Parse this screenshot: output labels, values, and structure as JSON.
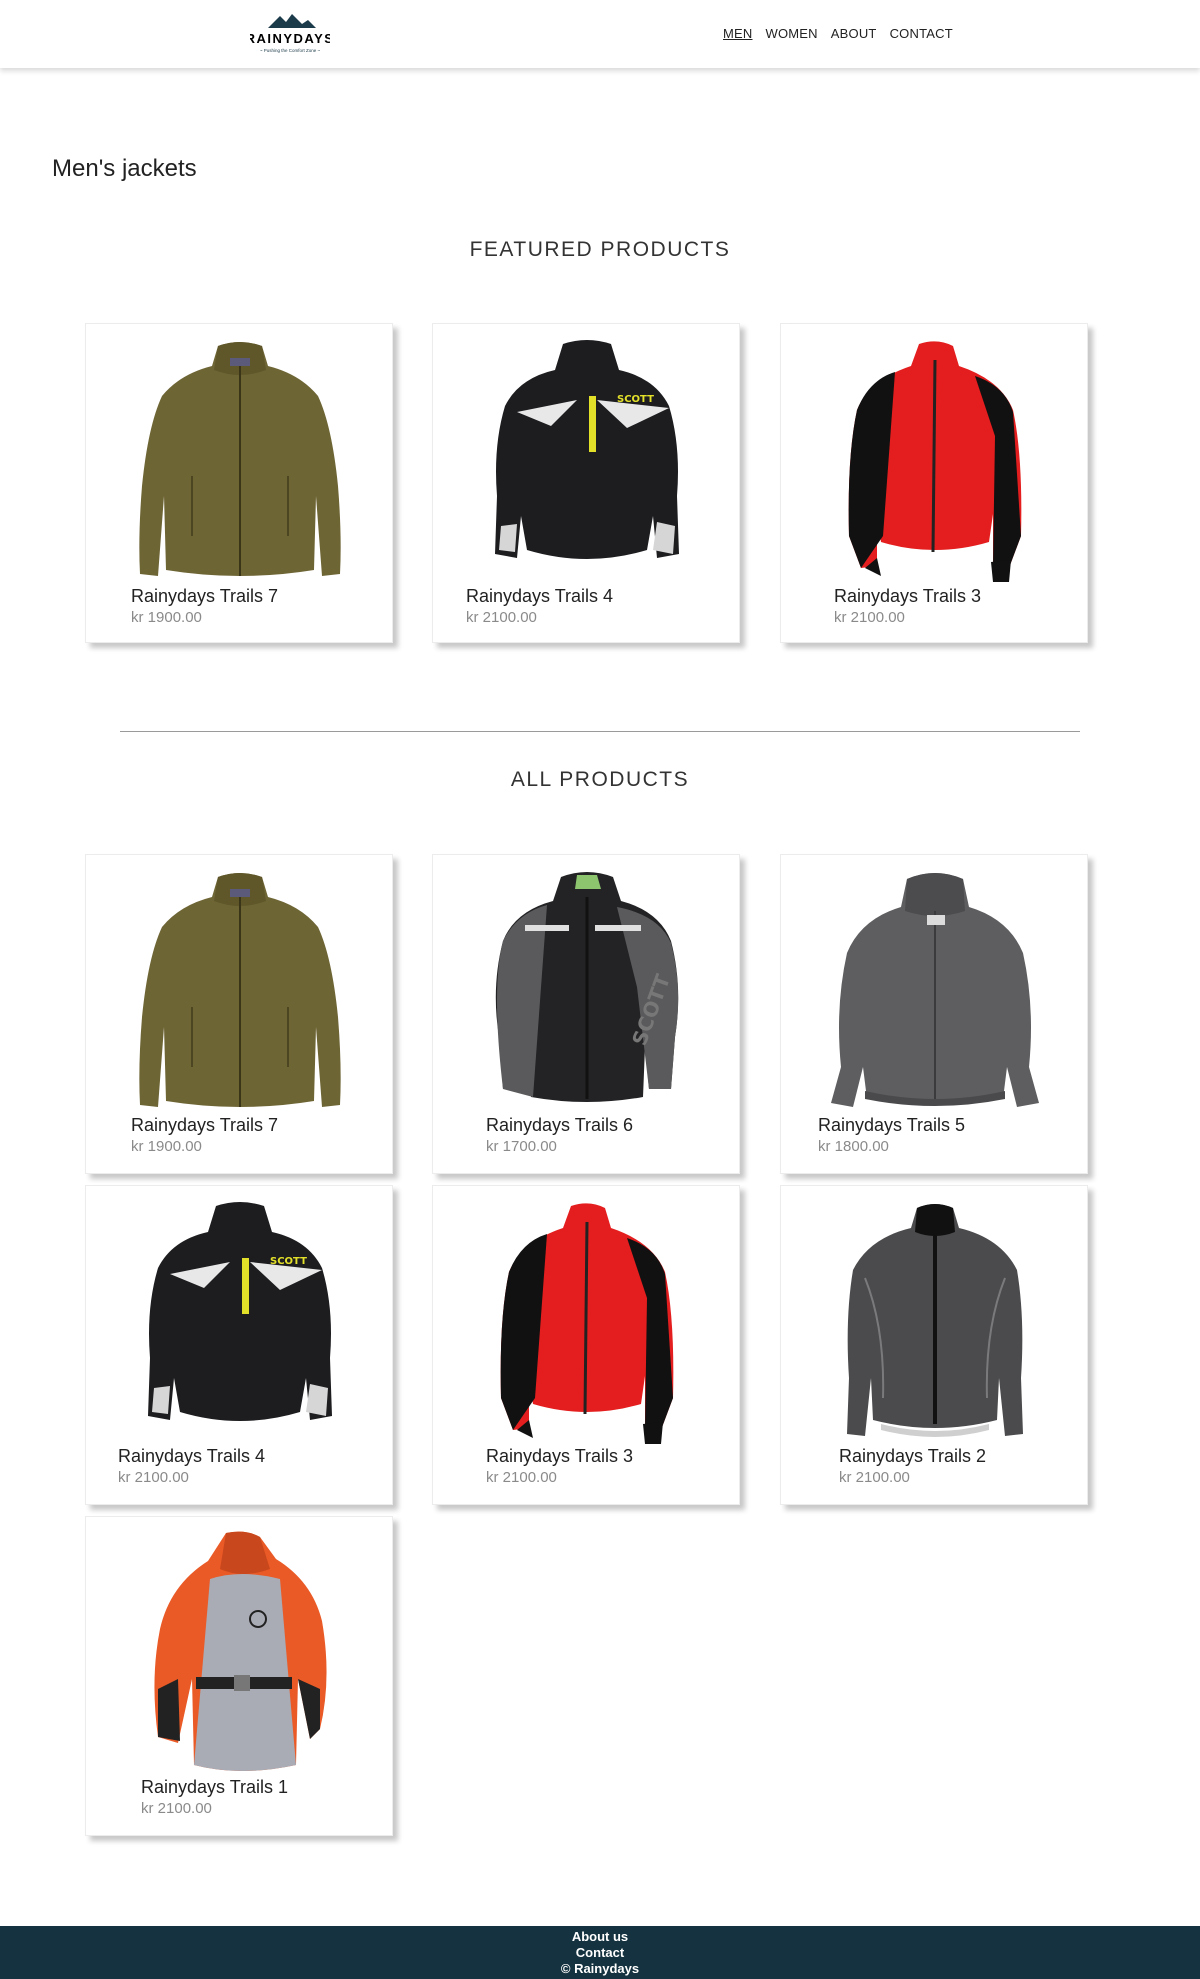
{
  "header": {
    "logo_text": "RAINYDAYS",
    "logo_tagline": "~ Pushing the Comfort Zone ~",
    "nav": [
      {
        "label": "MEN",
        "active": true
      },
      {
        "label": "WOMEN",
        "active": false
      },
      {
        "label": "ABOUT",
        "active": false
      },
      {
        "label": "CONTACT",
        "active": false
      }
    ]
  },
  "page_title": "Men's jackets",
  "featured": {
    "title": "FEATURED PRODUCTS",
    "products": [
      {
        "name": "Rainydays Trails 7",
        "price": "kr 1900.00",
        "icon": "olive-fleece-jacket"
      },
      {
        "name": "Rainydays Trails 4",
        "price": "kr 2100.00",
        "icon": "black-scott-jacket"
      },
      {
        "name": "Rainydays Trails 3",
        "price": "kr 2100.00",
        "icon": "red-running-jacket"
      }
    ]
  },
  "all": {
    "title": "ALL PRODUCTS",
    "products": [
      {
        "name": "Rainydays Trails 7",
        "price": "kr 1900.00",
        "icon": "olive-fleece-jacket"
      },
      {
        "name": "Rainydays Trails 6",
        "price": "kr 1700.00",
        "icon": "black-grey-scott-jacket"
      },
      {
        "name": "Rainydays Trails 5",
        "price": "kr 1800.00",
        "icon": "grey-bomber-jacket"
      },
      {
        "name": "Rainydays Trails 4",
        "price": "kr 2100.00",
        "icon": "black-scott-jacket"
      },
      {
        "name": "Rainydays Trails 3",
        "price": "kr 2100.00",
        "icon": "red-running-jacket"
      },
      {
        "name": "Rainydays Trails 2",
        "price": "kr 2100.00",
        "icon": "dark-grey-shell-jacket"
      },
      {
        "name": "Rainydays Trails 1",
        "price": "kr 2100.00",
        "icon": "orange-sailing-jacket"
      }
    ]
  },
  "footer": {
    "about": "About us",
    "contact": "Contact",
    "copyright": "© Rainydays"
  },
  "colors": {
    "brand_navy": "#14323f",
    "olive": "#6e6535",
    "black": "#1d1d20",
    "red": "#e41e1e",
    "grey": "#5e5e60",
    "orange": "#ea5a26"
  }
}
